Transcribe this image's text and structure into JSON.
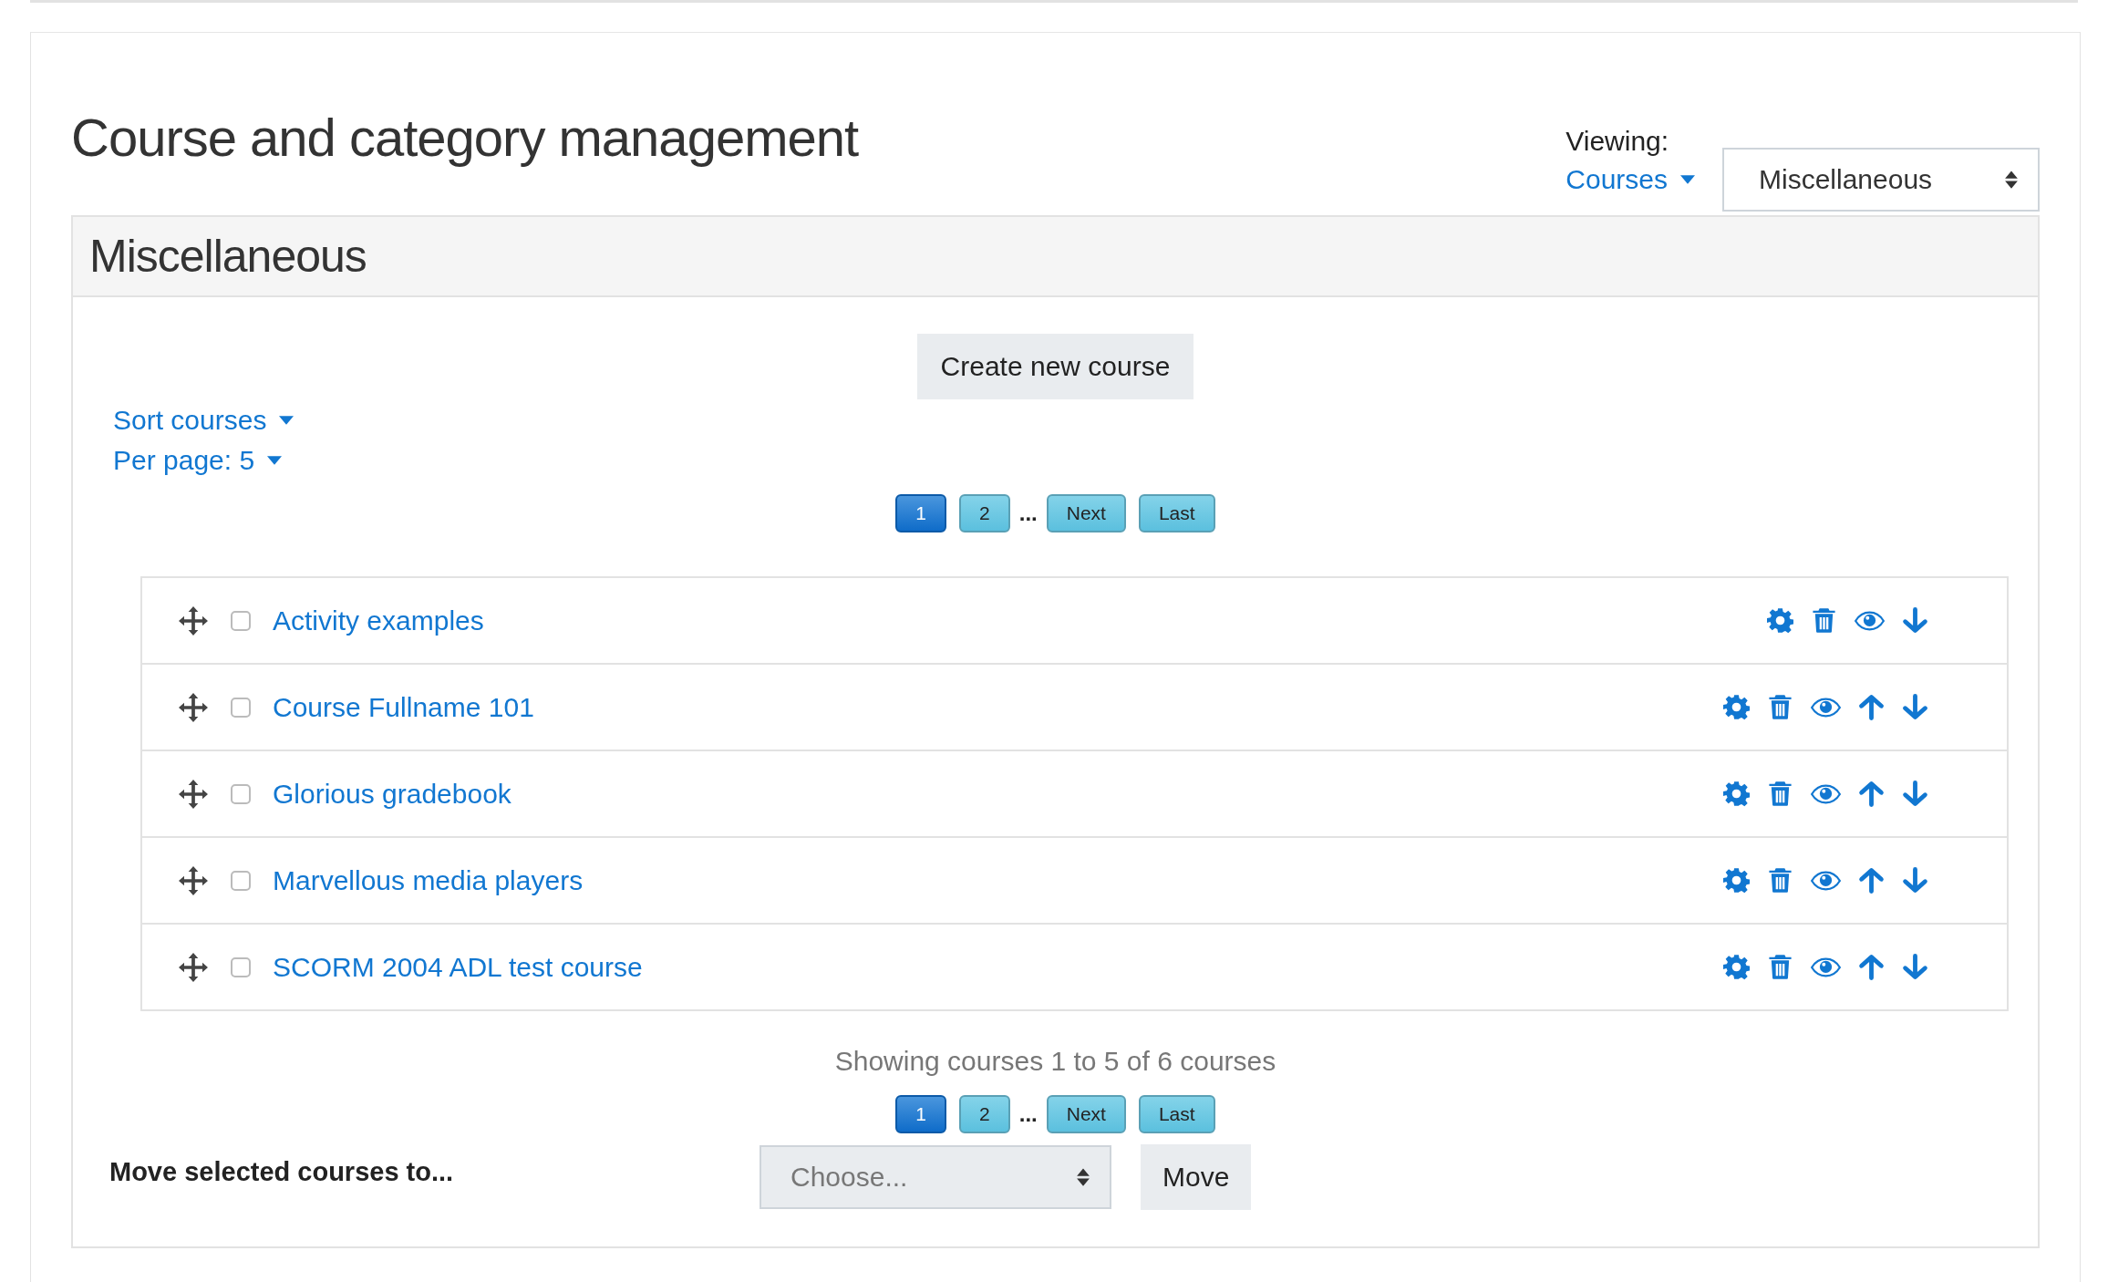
{
  "page_title": "Course and category management",
  "viewing": {
    "label": "Viewing:",
    "mode": "Courses",
    "category": "Miscellaneous"
  },
  "category_panel": {
    "title": "Miscellaneous",
    "create_button": "Create new course",
    "sort_link": "Sort courses",
    "per_page_link": "Per page: 5",
    "pagination_top": [
      {
        "label": "1",
        "kind": "page",
        "selected": true
      },
      {
        "label": "2",
        "kind": "page",
        "selected": false
      },
      {
        "label": "...",
        "kind": "ellipsis"
      },
      {
        "label": "Next",
        "kind": "page",
        "selected": false
      },
      {
        "label": "Last",
        "kind": "page",
        "selected": false
      }
    ],
    "courses": [
      {
        "name": "Activity examples",
        "checked": false,
        "actions": [
          {
            "kind": "settings"
          },
          {
            "kind": "delete"
          },
          {
            "kind": "hide"
          },
          {
            "kind": "down"
          }
        ]
      },
      {
        "name": "Course Fullname 101",
        "checked": false,
        "actions": [
          {
            "kind": "settings"
          },
          {
            "kind": "delete"
          },
          {
            "kind": "hide"
          },
          {
            "kind": "up"
          },
          {
            "kind": "down"
          }
        ]
      },
      {
        "name": "Glorious gradebook",
        "checked": false,
        "actions": [
          {
            "kind": "settings"
          },
          {
            "kind": "delete"
          },
          {
            "kind": "hide"
          },
          {
            "kind": "up"
          },
          {
            "kind": "down"
          }
        ]
      },
      {
        "name": "Marvellous media players",
        "checked": false,
        "actions": [
          {
            "kind": "settings"
          },
          {
            "kind": "delete"
          },
          {
            "kind": "hide"
          },
          {
            "kind": "up"
          },
          {
            "kind": "down"
          }
        ]
      },
      {
        "name": "SCORM 2004 ADL test course",
        "checked": false,
        "actions": [
          {
            "kind": "settings"
          },
          {
            "kind": "delete"
          },
          {
            "kind": "hide"
          },
          {
            "kind": "up"
          },
          {
            "kind": "down"
          }
        ]
      }
    ],
    "summary": "Showing courses 1 to 5 of 6 courses",
    "pagination_bottom": [
      {
        "label": "1",
        "kind": "page",
        "selected": true
      },
      {
        "label": "2",
        "kind": "page",
        "selected": false
      },
      {
        "label": "...",
        "kind": "ellipsis"
      },
      {
        "label": "Next",
        "kind": "page",
        "selected": false
      },
      {
        "label": "Last",
        "kind": "page",
        "selected": false
      }
    ],
    "move": {
      "label": "Move selected courses to...",
      "placeholder": "Choose...",
      "button": "Move"
    }
  }
}
